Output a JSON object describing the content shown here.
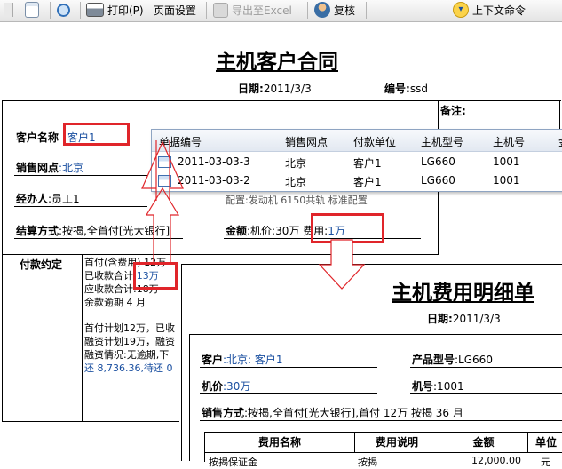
{
  "toolbar": {
    "print": "打印(P)",
    "page_setup": "页面设置",
    "export_excel": "导出至Excel",
    "review": "复核",
    "context_cmd": "上下文命令"
  },
  "contract": {
    "title": "主机客户合同",
    "date_label": "日期:",
    "date": "2011/3/3",
    "no_label": "编号:",
    "no": "ssd",
    "remark_label": "备注:",
    "customer_label": "客户名称",
    "customer": "客户1",
    "outlet_label": "销售网点",
    "outlet": ":北京",
    "agent_label": "经办人",
    "agent": ":员工1",
    "partial_hidden": "配置:发动机 6150共轨 标准配置",
    "settle_label": "结算方式",
    "settle": ":按揭,全首付[光大银行]",
    "amount_label": "金额",
    "amount_text": ":机价:30万 费用:",
    "amount_fee": "1万",
    "pay_label": "付款约定",
    "pay_lines": [
      "首付(含费用) 12万",
      "已收款合计:",
      "应收款合计:18万 =",
      "余款逾期 4 月",
      "首付计划12万，已收",
      "融资计划19万，融资",
      "融资情况:无逾期,下",
      "还 8,736.36,待还 0"
    ],
    "received": "13万"
  },
  "popup": {
    "headers": [
      "单据编号",
      "销售网点",
      "付款单位",
      "主机型号",
      "主机号",
      "金"
    ],
    "rows": [
      [
        "2011-03-03-3",
        "北京",
        "客户1",
        "LG660",
        "1001"
      ],
      [
        "2011-03-03-2",
        "北京",
        "客户1",
        "LG660",
        "1001"
      ]
    ]
  },
  "detail": {
    "title": "主机费用明细单",
    "date_label": "日期:",
    "date": "2011/3/3",
    "customer_label": "客户",
    "customer": ":北京: 客户1",
    "model_label": "产品型号",
    "model": ":LG660",
    "price_label": "机价",
    "price": ":30万",
    "machine_no_label": "机号",
    "machine_no": ":1001",
    "settle_label": "销售方式",
    "settle": ":按揭,全首付[光大银行],首付  12万  按揭  36 月",
    "table_headers": [
      "费用名称",
      "费用说明",
      "金额",
      "单位"
    ],
    "row1": [
      "按揭保证金",
      "按揭",
      "12,000.00",
      "元"
    ]
  },
  "colors": {
    "highlight": "#e0252a",
    "link_blue": "#1a4fa0"
  }
}
